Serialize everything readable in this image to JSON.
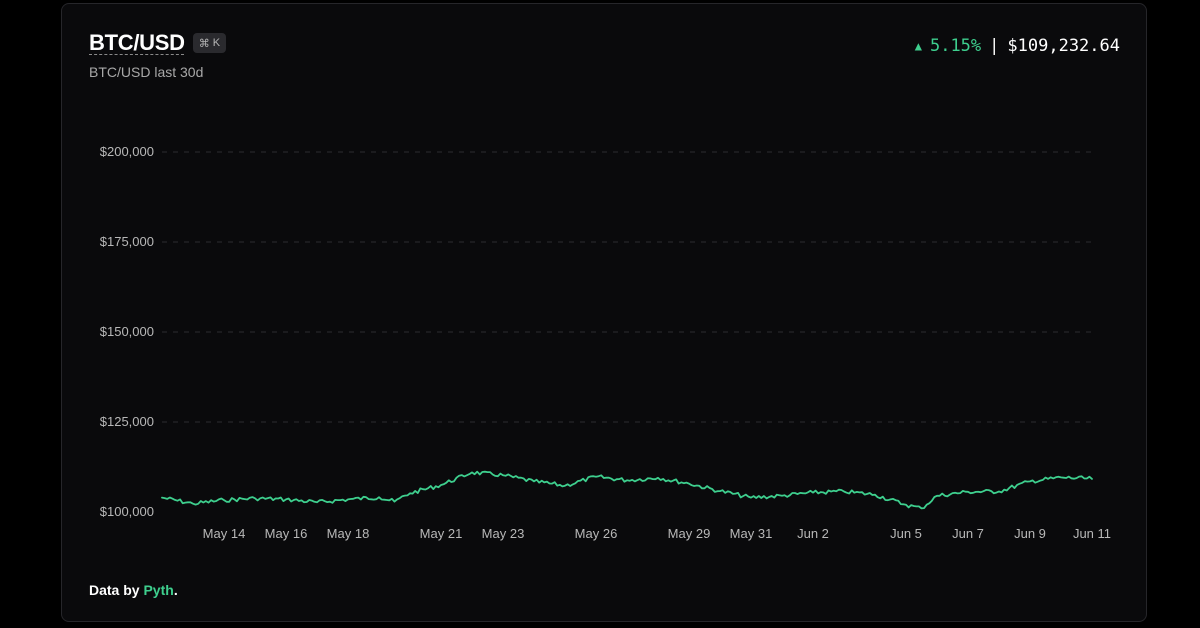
{
  "header": {
    "title": "BTC/USD",
    "shortcut_symbol": "⌘",
    "shortcut_key": "K",
    "subtitle": "BTC/USD last 30d",
    "change": "5.15%",
    "separator": "|",
    "price": "$109,232.64"
  },
  "footer": {
    "prefix": "Data by ",
    "link": "Pyth",
    "suffix": "."
  },
  "colors": {
    "line": "#3ecf8e",
    "grid": "#2c2c30",
    "axis_text": "#b8b8b8"
  },
  "chart_data": {
    "type": "line",
    "title": "",
    "xlabel": "",
    "ylabel": "",
    "ylim": [
      100000,
      200000
    ],
    "y_ticks": [
      100000,
      125000,
      150000,
      175000,
      200000
    ],
    "y_tick_labels": [
      "$100,000",
      "$125,000",
      "$150,000",
      "$175,000",
      "$200,000"
    ],
    "x_ticks": [
      "2025-05-14",
      "2025-05-16",
      "2025-05-18",
      "2025-05-21",
      "2025-05-23",
      "2025-05-26",
      "2025-05-29",
      "2025-05-31",
      "2025-06-02",
      "2025-06-05",
      "2025-06-07",
      "2025-06-09",
      "2025-06-11"
    ],
    "x_tick_labels": [
      "May 14",
      "May 16",
      "May 18",
      "May 21",
      "May 23",
      "May 26",
      "May 29",
      "May 31",
      "Jun 2",
      "Jun 5",
      "Jun 7",
      "Jun 9",
      "Jun 11"
    ],
    "grid": "horizontal dashed",
    "series": [
      {
        "points": [
          [
            "2025-05-12",
            104000
          ],
          [
            "2025-05-13",
            102300
          ],
          [
            "2025-05-14",
            103300
          ],
          [
            "2025-05-15",
            103800
          ],
          [
            "2025-05-16",
            103500
          ],
          [
            "2025-05-17",
            102700
          ],
          [
            "2025-05-18",
            103500
          ],
          [
            "2025-05-19",
            104100
          ],
          [
            "2025-05-19T12:00",
            102900
          ],
          [
            "2025-05-20",
            105200
          ],
          [
            "2025-05-21",
            107500
          ],
          [
            "2025-05-22",
            111000
          ],
          [
            "2025-05-23",
            110200
          ],
          [
            "2025-05-24",
            108500
          ],
          [
            "2025-05-25",
            107300
          ],
          [
            "2025-05-26",
            109800
          ],
          [
            "2025-05-27",
            108800
          ],
          [
            "2025-05-28",
            109500
          ],
          [
            "2025-05-29",
            107900
          ],
          [
            "2025-05-30",
            105800
          ],
          [
            "2025-05-31",
            104000
          ],
          [
            "2025-06-01",
            104500
          ],
          [
            "2025-06-02",
            105400
          ],
          [
            "2025-06-03",
            105700
          ],
          [
            "2025-06-04",
            104800
          ],
          [
            "2025-06-05",
            102000
          ],
          [
            "2025-06-05T12:00",
            101000
          ],
          [
            "2025-06-06",
            104500
          ],
          [
            "2025-06-07",
            105600
          ],
          [
            "2025-06-08",
            105700
          ],
          [
            "2025-06-09",
            108500
          ],
          [
            "2025-06-10",
            109600
          ],
          [
            "2025-06-11",
            109200
          ]
        ]
      }
    ]
  }
}
